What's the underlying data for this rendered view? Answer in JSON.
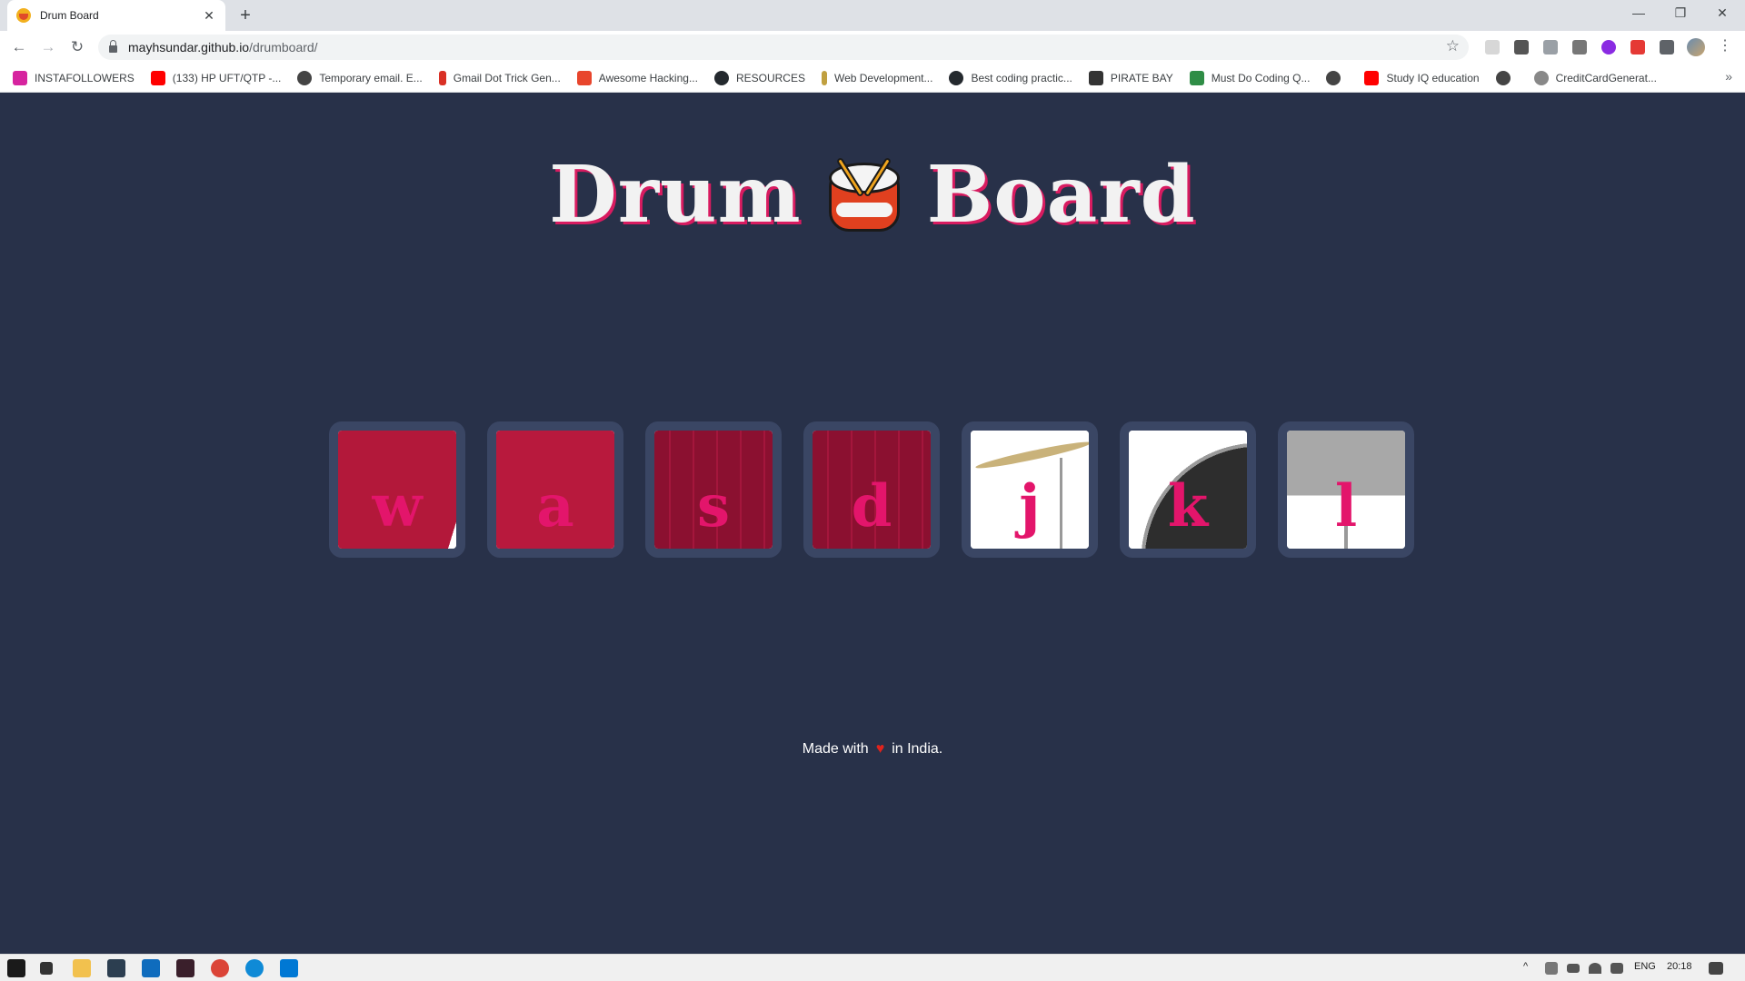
{
  "browser": {
    "tab_title": "Drum Board",
    "tab_close": "✕",
    "new_tab": "+",
    "window_controls": {
      "minimize": "—",
      "restore": "❐",
      "close": "✕"
    },
    "nav": {
      "back": "←",
      "forward": "→",
      "reload": "↻"
    },
    "url_host": "mayhsundar.github.io",
    "url_path": "/drumboard/",
    "bookmark_star": "☆",
    "menu": "⋮"
  },
  "bookmarks": {
    "items": [
      {
        "label": "INSTAFOLLOWERS",
        "color": "#d6249f"
      },
      {
        "label": "(133) HP UFT/QTP -...",
        "color": "#ff0000"
      },
      {
        "label": "Temporary email. E...",
        "color": "#444444"
      },
      {
        "label": "Gmail Dot Trick Gen...",
        "color": "#d93025"
      },
      {
        "label": "Awesome Hacking...",
        "color": "#e8452c"
      },
      {
        "label": "RESOURCES",
        "color": "#24292e"
      },
      {
        "label": "Web Development...",
        "color": "#c0a040"
      },
      {
        "label": "Best coding practic...",
        "color": "#24292e"
      },
      {
        "label": "PIRATE BAY",
        "color": "#333333"
      },
      {
        "label": "Must Do Coding Q...",
        "color": "#2f8d46"
      },
      {
        "label": "",
        "color": "#444444"
      },
      {
        "label": "Study IQ education",
        "color": "#ff0000"
      },
      {
        "label": "",
        "color": "#444444"
      },
      {
        "label": "CreditCardGenerat...",
        "color": "#888888"
      }
    ],
    "more": "»"
  },
  "page": {
    "title_left": "Drum",
    "title_right": "Board",
    "keys": [
      {
        "letter": "w"
      },
      {
        "letter": "a"
      },
      {
        "letter": "s"
      },
      {
        "letter": "d"
      },
      {
        "letter": "j"
      },
      {
        "letter": "k"
      },
      {
        "letter": "l"
      }
    ],
    "footer_pre": "Made with",
    "footer_heart": "♥",
    "footer_post": "in India."
  },
  "taskbar": {
    "lang": "ENG",
    "time": "20:18"
  },
  "colors": {
    "page_bg": "#283149",
    "accent": "#e3156b"
  }
}
